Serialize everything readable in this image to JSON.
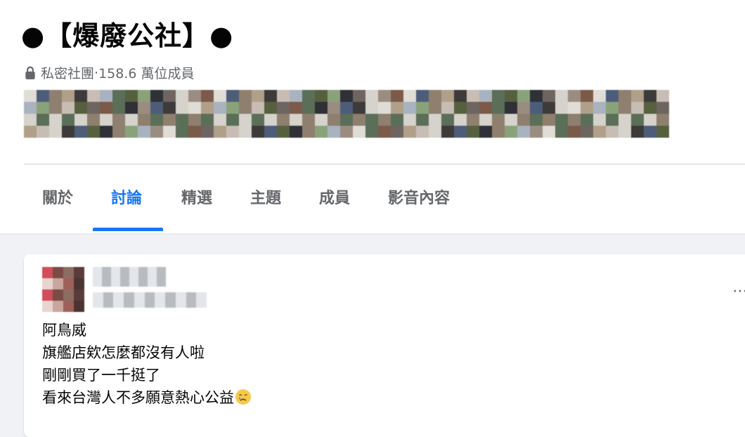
{
  "group": {
    "title": "●【爆廢公社】●",
    "privacy": "私密社團",
    "separator": " · ",
    "members": "158.6 萬位成員"
  },
  "tabs": [
    {
      "label": "關於",
      "active": false
    },
    {
      "label": "討論",
      "active": true
    },
    {
      "label": "精選",
      "active": false
    },
    {
      "label": "主題",
      "active": false
    },
    {
      "label": "成員",
      "active": false
    },
    {
      "label": "影音內容",
      "active": false
    }
  ],
  "post": {
    "more_label": "⋯",
    "lines": [
      "阿鳥威",
      "旗艦店欸怎麼都沒有人啦",
      "剛剛買了一千挺了",
      "看來台灣人不多願意熱心公益"
    ],
    "emoji": "sad-relieved-face-icon"
  },
  "colors": {
    "accent": "#1877f2",
    "secondary_text": "#65676b",
    "background": "#f0f2f5"
  }
}
